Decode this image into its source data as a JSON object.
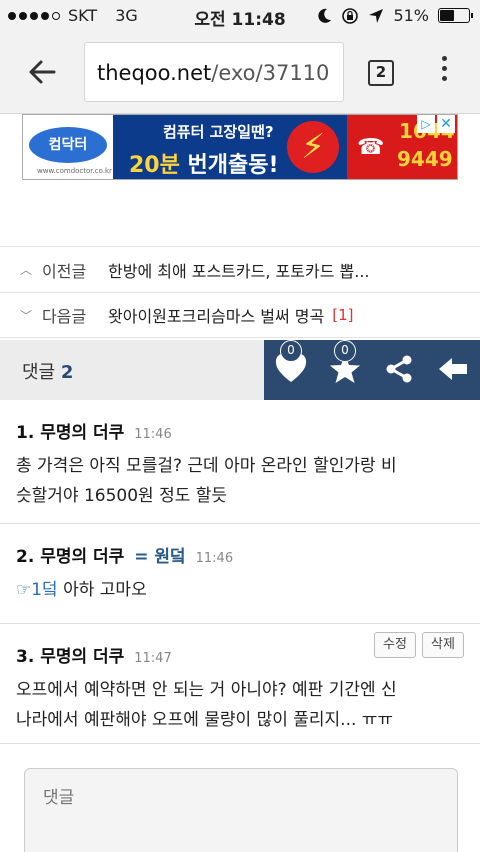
{
  "status": {
    "carrier": "SKT",
    "network": "3G",
    "time": "오전 11:48",
    "battery": "51%",
    "battery_level": 0.51
  },
  "browser": {
    "url_domain": "theqoo.net",
    "url_path": "/exo/37110",
    "tab_count": "2"
  },
  "ad": {
    "brand": "컴닥터",
    "brand_sub": "www.comdoctor.co.kr",
    "headline": "컴퓨터 고장일땐?",
    "tagline_accent": "20분",
    "tagline": " 번개출동!",
    "phone_line1": "1644",
    "phone_line2": "9449",
    "info_icon": "info-icon",
    "close_icon": "close-icon"
  },
  "nav": {
    "prev_label": "이전글",
    "prev_title": "한방에 최애 포스트카드, 포토카드 뽑...",
    "next_label": "다음글",
    "next_title": "왓아이원포크리슴마스 벌써 명곡",
    "next_count": "[1]"
  },
  "comments_bar": {
    "label": "댓글",
    "count": "2",
    "like_count": "0",
    "star_count": "0"
  },
  "comments": [
    {
      "head": "1. 무명의 더쿠",
      "time": "11:46",
      "body_line1": "총 가격은 아직 모를걸? 근데 아마 온라인 할인가랑 비",
      "body_line2": "슷할거야 16500원 정도 할듯"
    },
    {
      "head": "2. 무명의 더쿠",
      "tag": "= 원덬",
      "time": "11:46",
      "ref": "☞1덬",
      "body": " 아하 고마오"
    },
    {
      "head": "3. 무명의 더쿠",
      "time": "11:47",
      "edit_label": "수정",
      "delete_label": "삭제",
      "body_line1": "오프에서 예약하면 안 되는 거 아니야? 예판 기간엔 신",
      "body_line2": "나라에서 예판해야 오프에 물량이 많이 풀리지... ㅠㅠ"
    }
  ],
  "reply": {
    "placeholder": "댓글"
  }
}
